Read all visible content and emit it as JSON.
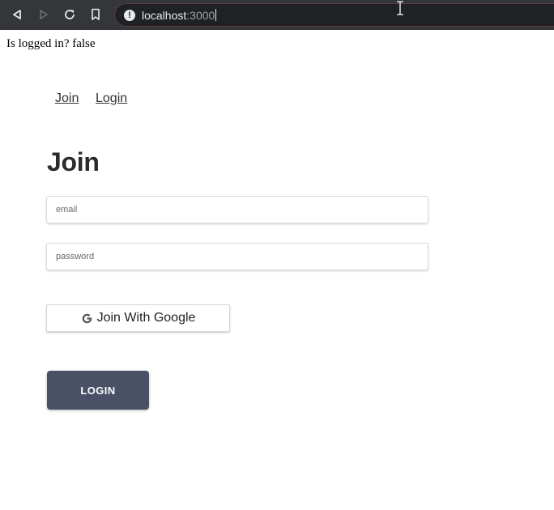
{
  "browser": {
    "back_icon": "back-arrow-icon",
    "forward_icon": "forward-arrow-icon",
    "reload_icon": "reload-icon",
    "bookmark_icon": "bookmark-icon",
    "site_info_icon": "info-icon",
    "url_host": "localhost",
    "url_port": ":3000"
  },
  "page": {
    "login_status": "Is logged in? false",
    "nav": {
      "join": "Join",
      "login": "Login"
    },
    "heading": "Join",
    "email_placeholder": "email",
    "password_placeholder": "password",
    "google_button": "Join With Google",
    "login_button": "LOGIN"
  },
  "colors": {
    "toolbar": "#35363a",
    "omnibox": "#202124",
    "login_button": "#4a5065",
    "heading": "#2b2b2b"
  }
}
